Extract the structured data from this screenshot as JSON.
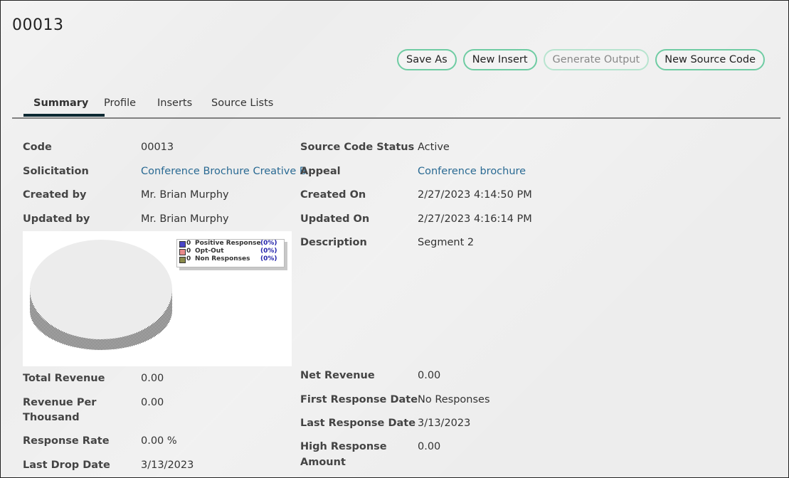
{
  "page": {
    "title": "00013"
  },
  "actions": [
    {
      "label": "Save As",
      "enabled": true
    },
    {
      "label": "New Insert",
      "enabled": true
    },
    {
      "label": "Generate Output",
      "enabled": false
    },
    {
      "label": "New Source Code",
      "enabled": true
    }
  ],
  "tabs": [
    {
      "label": "Summary",
      "active": true
    },
    {
      "label": "Profile",
      "active": false
    },
    {
      "label": "Inserts",
      "active": false
    },
    {
      "label": "Source Lists",
      "active": false
    }
  ],
  "left_fields": {
    "code": {
      "label": "Code",
      "value": "00013"
    },
    "solicitation": {
      "label": "Solicitation",
      "value": "Conference Brochure Creative B"
    },
    "created_by": {
      "label": "Created by",
      "value": "Mr. Brian Murphy"
    },
    "updated_by": {
      "label": "Updated by",
      "value": "Mr. Brian Murphy"
    },
    "total_revenue": {
      "label": "Total Revenue",
      "value": "0.00"
    },
    "revenue_per_thousand": {
      "label_line1": "Revenue Per",
      "label_line2": "Thousand",
      "value": "0.00"
    },
    "response_rate": {
      "label": "Response Rate",
      "value": "0.00 %"
    },
    "last_drop_date": {
      "label": "Last Drop Date",
      "value": "3/13/2023"
    }
  },
  "right_fields": {
    "status": {
      "label": "Source Code Status",
      "value": "Active"
    },
    "appeal": {
      "label": "Appeal",
      "value": "Conference brochure"
    },
    "created_on": {
      "label": "Created On",
      "value": "2/27/2023 4:14:50 PM"
    },
    "updated_on": {
      "label": "Updated On",
      "value": "2/27/2023 4:16:14 PM"
    },
    "description": {
      "label": "Description",
      "value": "Segment 2"
    },
    "net_revenue": {
      "label": "Net Revenue",
      "value": "0.00"
    },
    "first_response_date": {
      "label": "First Response Date",
      "value": "No Responses"
    },
    "last_response_date": {
      "label": "Last Response Date",
      "value": "3/13/2023"
    },
    "high_response_amount": {
      "label_line1": "High Response",
      "label_line2": "Amount",
      "value": "0.00"
    }
  },
  "chart_data": {
    "type": "pie",
    "title": "",
    "categories": [
      "Positive Response",
      "Opt-Out",
      "Non Responses"
    ],
    "values": [
      0,
      0,
      0
    ],
    "percentages": [
      "(0%)",
      "(0%)",
      "(0%)"
    ],
    "colors": [
      "#4a45c8",
      "#e88a8a",
      "#8a8a4a"
    ],
    "legend_position": "top-right"
  }
}
